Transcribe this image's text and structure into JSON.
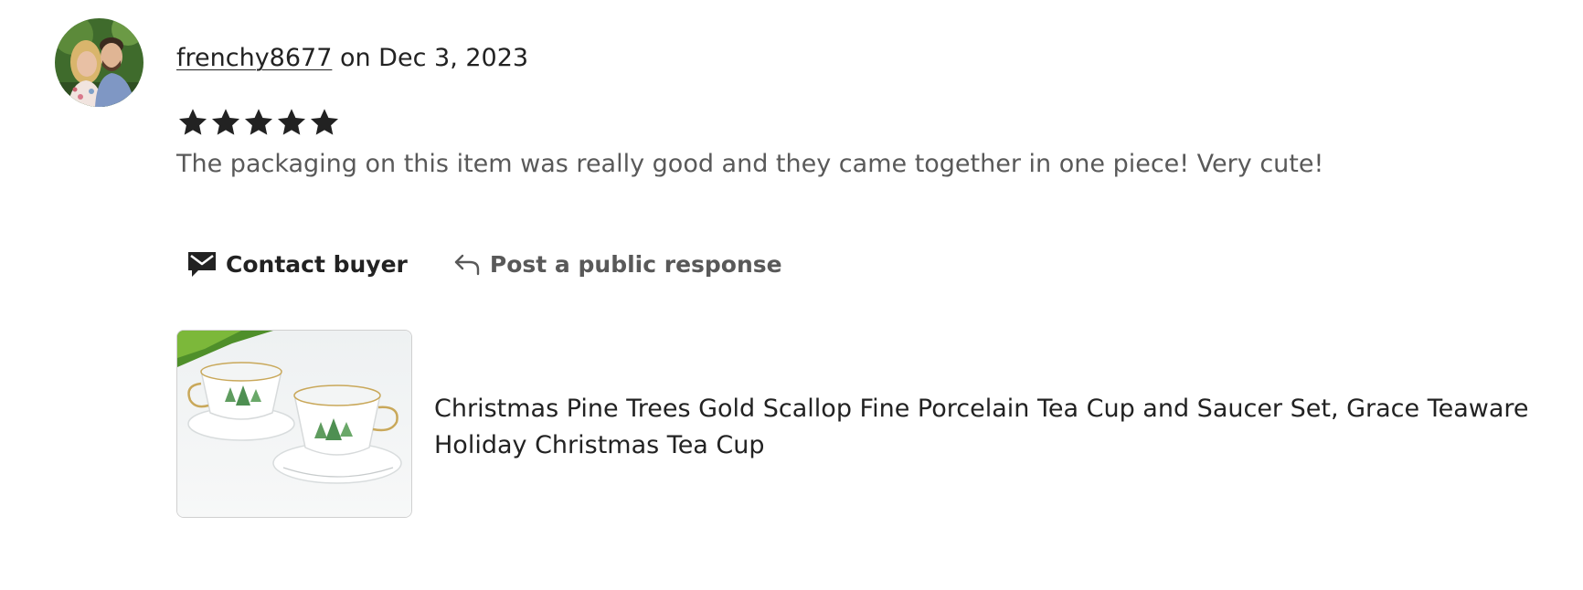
{
  "review": {
    "username": "frenchy8677",
    "date_text": " on Dec 3, 2023",
    "rating": 5,
    "rating_max": 5,
    "text": "The packaging on this item was really good and they came together in one piece! Very cute!"
  },
  "actions": {
    "contact_label": "Contact buyer",
    "contact_icon": "envelope-icon",
    "post_label": "Post a public response",
    "post_icon": "reply-arrow-icon"
  },
  "listing": {
    "title": "Christmas Pine Trees Gold Scallop Fine Porcelain Tea Cup and Saucer Set, Grace Teaware Holiday Christmas Tea Cup"
  },
  "colors": {
    "primary_text": "#222222",
    "secondary_text": "#595959",
    "star": "#222222"
  }
}
